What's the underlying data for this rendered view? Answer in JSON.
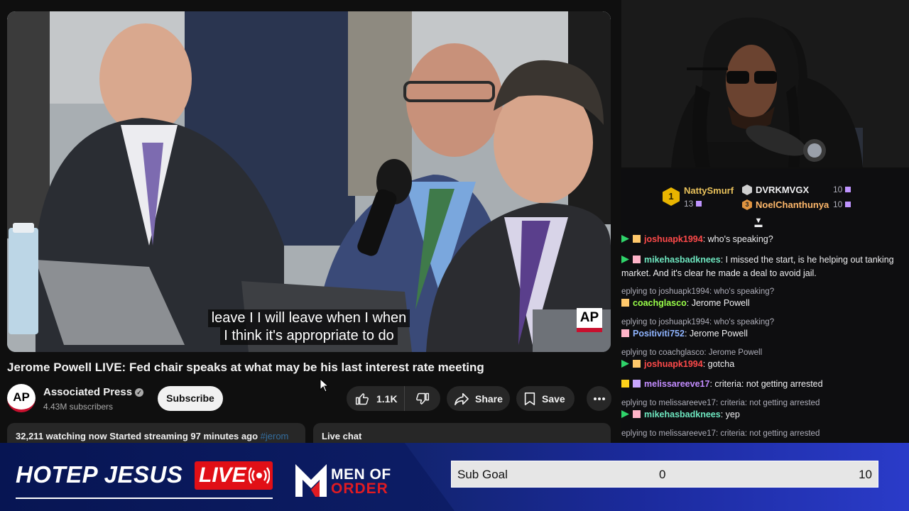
{
  "video": {
    "captions": [
      "leave I I will leave when I when",
      "I think it's appropriate to do"
    ],
    "watermark": "AP"
  },
  "video_info": {
    "title": "Jerome Powell LIVE: Fed chair speaks at what may be his last interest rate meeting",
    "channel_avatar_text": "AP",
    "channel_name": "Associated Press",
    "subscribers": "4.43M subscribers",
    "subscribe_label": "Subscribe",
    "like_count": "1.1K",
    "share_label": "Share",
    "save_label": "Save",
    "watching": "32,211 watching now",
    "started": "Started streaming 97 minutes ago",
    "hashtag": "#jerom",
    "live_chat_label": "Live chat"
  },
  "leaderboard": {
    "first": {
      "rank": "1",
      "name": "NattySmurf",
      "count": "13"
    },
    "second": {
      "name": "DVRKMVGX",
      "count": "10"
    },
    "third": {
      "rank": "3",
      "name": "NoelChanthunya",
      "count": "10"
    }
  },
  "chat": {
    "messages": [
      {
        "user": "joshuapk1994",
        "text": "who's speaking?",
        "color": "#ff4a4a"
      },
      {
        "user": "mikehasbadknees",
        "text": "I missed the start, is he helping out tanking",
        "text2": "market. And it's clear he made a deal to avoid jail.",
        "color": "#6ee7c0"
      },
      {
        "reply": "eplying to joshuapk1994: who's speaking?"
      },
      {
        "user": "coachglasco",
        "text": "Jerome Powell",
        "color": "#9aff4a"
      },
      {
        "reply": "eplying to joshuapk1994: who's speaking?"
      },
      {
        "user": "Positiviti752",
        "text": "Jerome Powell",
        "color": "#8fb4ff"
      },
      {
        "reply": "eplying to coachglasco: Jerome Powell"
      },
      {
        "user": "joshuapk1994",
        "text": "gotcha",
        "color": "#ff4a4a"
      },
      {
        "user": "melissareeve17",
        "text": "criteria: not getting arrested",
        "color": "#c38cff"
      },
      {
        "reply": "eplying to melissareeve17: criteria: not getting arrested"
      },
      {
        "user": "mikehasbadknees",
        "text": "yep",
        "color": "#6ee7c0"
      },
      {
        "reply": "eplying to melissareeve17: criteria: not getting arrested"
      }
    ]
  },
  "banner": {
    "streamer": "HOTEP JESUS",
    "live_label": "LIVE",
    "sponsor_line1": "MEN OF",
    "sponsor_line2": "ORDER",
    "goal_label": "Sub Goal",
    "goal_current": "0",
    "goal_target": "10",
    "goal_progress": 0
  },
  "colors": {
    "accent_red": "#e10f16",
    "banner_blue": "#0d1d66",
    "chat_bg": "#0e0e10",
    "leader_gold": "#e8c15b",
    "third_orange": "#ffb86b"
  },
  "icons": [
    "verified-icon",
    "thumbs-up-icon",
    "thumbs-down-icon",
    "share-icon",
    "bookmark-icon",
    "more-icon",
    "collapse-icon",
    "cursor-icon",
    "live-signal-icon"
  ]
}
